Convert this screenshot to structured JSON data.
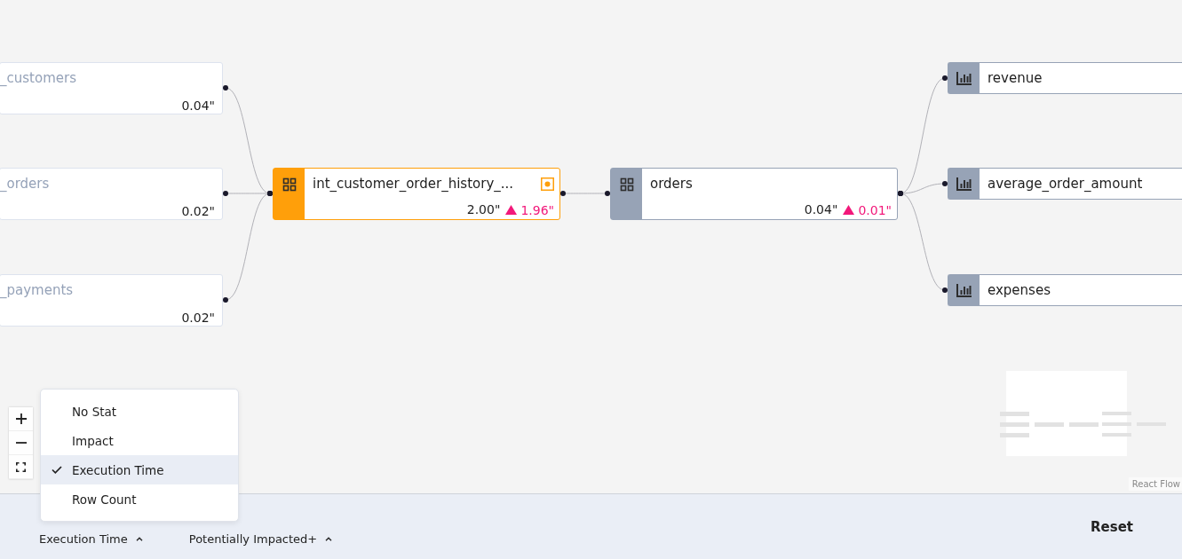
{
  "graph": {
    "columns": [
      [
        {
          "kind": "source",
          "name": "_customers",
          "time": "0.04\""
        },
        {
          "kind": "source",
          "name": "_orders",
          "time": "0.02\""
        },
        {
          "kind": "source",
          "name": "_payments",
          "time": "0.02\""
        }
      ],
      [
        {
          "kind": "model",
          "name": "int_customer_order_history_...",
          "time": "2.00\"",
          "delta": "1.96\"",
          "impacted": true
        }
      ],
      [
        {
          "kind": "model",
          "name": "orders",
          "time": "0.04\"",
          "delta": "0.01\"",
          "impacted": false
        }
      ],
      [
        {
          "kind": "metric",
          "name": "revenue"
        },
        {
          "kind": "metric",
          "name": "average_order_amount"
        },
        {
          "kind": "metric",
          "name": "expenses"
        }
      ]
    ]
  },
  "attribution": "React Flow",
  "stat_menu": [
    {
      "label": "No Stat",
      "selected": false
    },
    {
      "label": "Impact",
      "selected": false
    },
    {
      "label": "Execution Time",
      "selected": true
    },
    {
      "label": "Row Count",
      "selected": false
    }
  ],
  "toolbar": {
    "stat": "Execution Time",
    "filter": "Potentially Impacted+",
    "reset": "Reset"
  }
}
